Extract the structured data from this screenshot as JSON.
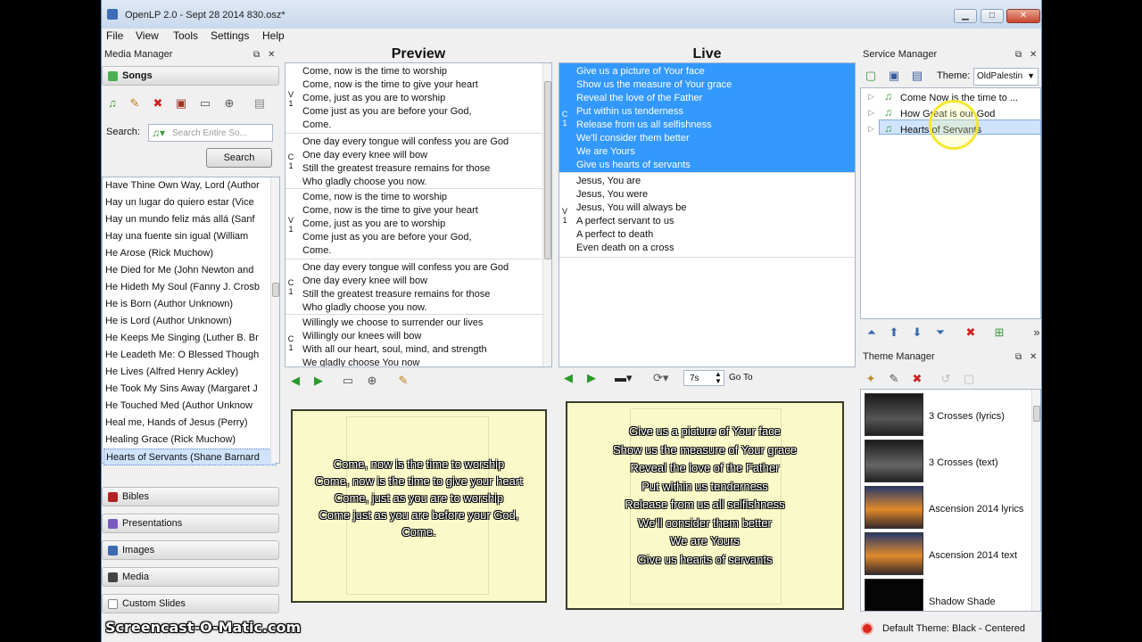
{
  "window": {
    "title": "OpenLP 2.0 - Sept 28 2014 830.osz*"
  },
  "menu": [
    "File",
    "View",
    "Tools",
    "Settings",
    "Help"
  ],
  "media_manager": {
    "title": "Media Manager",
    "songs_tab": "Songs",
    "search_label": "Search:",
    "search_placeholder": "Search Entire So...",
    "search_button": "Search",
    "songs": [
      "Have Thine Own Way, Lord (Author",
      "Hay un lugar do quiero estar (Vice",
      "Hay un mundo feliz más allá (Sanf",
      "Hay una fuente sin igual (William",
      "He Arose (Rick Muchow)",
      "He Died for Me (John Newton and",
      "He Hideth My Soul (Fanny J. Crosb",
      "He is Born (Author Unknown)",
      "He is Lord (Author Unknown)",
      "He Keeps Me Singing (Luther B. Br",
      "He Leadeth Me: O Blessed Though",
      "He Lives (Alfred Henry Ackley)",
      "He Took My Sins Away (Margaret J",
      "He Touched Med (Author Unknow",
      "Heal me, Hands of Jesus (Perry)",
      "Healing Grace (Rick Muchow)",
      "Hearts of Servants (Shane Barnard"
    ],
    "tabs": [
      "Bibles",
      "Presentations",
      "Images",
      "Media",
      "Custom Slides"
    ]
  },
  "preview": {
    "title": "Preview",
    "slides": [
      {
        "tag": "V\n1",
        "lines": [
          "Come, now is the time to worship",
          "Come, now is the time to give your heart",
          "Come, just as you are to worship",
          "Come just as you are before your God,",
          "Come."
        ]
      },
      {
        "tag": "C\n1",
        "lines": [
          "One day every tongue will confess you are God",
          "One day every knee will bow",
          "Still the greatest treasure remains for those",
          "Who gladly choose you now."
        ]
      },
      {
        "tag": "V\n1",
        "lines": [
          "Come, now is the time to worship",
          "Come, now is the time to give your heart",
          "Come, just as you are to worship",
          "Come just as you are before your God,",
          "Come."
        ]
      },
      {
        "tag": "C\n1",
        "lines": [
          "One day every tongue will confess you are God",
          "One day every knee will bow",
          "Still the greatest treasure remains for those",
          "Who gladly choose you now."
        ]
      },
      {
        "tag": "C\n1",
        "lines": [
          "Willingly we choose to surrender our lives",
          "Willingly our knees will bow",
          "With all our heart, soul, mind, and strength",
          "We gladly choose You now"
        ]
      }
    ],
    "display_lines": [
      "Come, now is the time to worship",
      "Come, now is the time to give your heart",
      "Come, just as you are to worship",
      "Come just as you are before your God,",
      "Come."
    ]
  },
  "live": {
    "title": "Live",
    "slides": [
      {
        "tag": "C\n1",
        "selected": true,
        "lines": [
          "Give us a picture of Your face",
          "Show us the measure of Your grace",
          "Reveal the love of the Father",
          "Put within us tenderness",
          "Release from us all selfishness",
          "We'll consider them better",
          "We are Yours",
          "Give us hearts of servants"
        ]
      },
      {
        "tag": "V\n1",
        "selected": false,
        "lines": [
          "Jesus, You are",
          "Jesus, You were",
          "Jesus, You will always be",
          "A perfect servant to us",
          "A perfect to death",
          "Even death on a cross"
        ]
      }
    ],
    "delay": "7s",
    "goto": "Go To",
    "display_lines": [
      "Give us a picture of Your face",
      "Show us the measure of Your grace",
      "Reveal the love of the Father",
      "Put within us tenderness",
      "Release from us all selfishness",
      "We'll consider them better",
      "We are Yours",
      "Give us hearts of servants"
    ]
  },
  "service_manager": {
    "title": "Service Manager",
    "theme_label": "Theme:",
    "theme_value": "OldPalestin",
    "items": [
      "Come Now is the time to ...",
      "How Great is our God",
      "Hearts of Servants"
    ]
  },
  "theme_manager": {
    "title": "Theme Manager",
    "themes": [
      "3 Crosses (lyrics)",
      "3 Crosses (text)",
      "Ascension 2014 lyrics",
      "Ascension 2014 text",
      "Shadow Shade"
    ]
  },
  "status": {
    "default_theme": "Default Theme: Black - Centered"
  },
  "watermark": "Screencast-O-Matic.com"
}
